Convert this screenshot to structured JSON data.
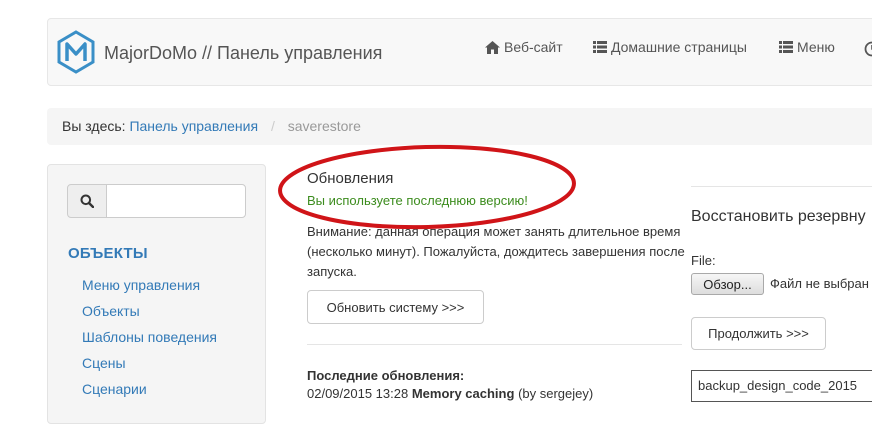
{
  "header": {
    "brand": "MajorDoMo // Панель управления",
    "nav": [
      {
        "label": "Веб-сайт",
        "icon": "home-icon"
      },
      {
        "label": "Домашние страницы",
        "icon": "list-icon"
      },
      {
        "label": "Меню",
        "icon": "list-icon"
      }
    ]
  },
  "breadcrumb": {
    "prefix": "Вы здесь:",
    "link": "Панель управления",
    "separator": "/",
    "current": "saverestore"
  },
  "sidebar": {
    "search_value": "",
    "heading": "ОБЪЕКТЫ",
    "items": [
      "Меню управления",
      "Объекты",
      "Шаблоны поведения",
      "Сцены",
      "Сценарии"
    ]
  },
  "updates": {
    "title": "Обновления",
    "status": "Вы используете последнюю версию!",
    "warning": "Внимание: данная операция может занять длительное время (несколько минут). Пожалуйста, дождитесь завершения после запуска.",
    "update_button": "Обновить систему >>>",
    "last_title": "Последние обновления:",
    "last_entry": {
      "datetime": "02/09/2015 13:28",
      "name": "Memory caching",
      "author": "(by sergejey)"
    }
  },
  "restore": {
    "title": "Восстановить резервну",
    "file_label": "File:",
    "browse_button": "Обзор...",
    "no_file": "Файл не выбран",
    "continue_button": "Продолжить >>>",
    "backup_item": "backup_design_code_2015"
  },
  "colors": {
    "link": "#337ab7",
    "success": "#3c8c1e",
    "highlight": "#d01418"
  }
}
